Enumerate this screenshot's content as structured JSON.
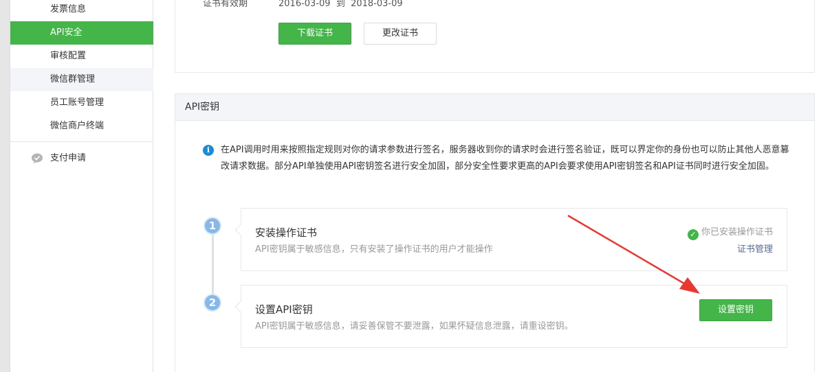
{
  "sidebar": {
    "items": [
      {
        "label": "发票信息"
      },
      {
        "label": "API安全"
      },
      {
        "label": "审核配置"
      },
      {
        "label": "微信群管理"
      },
      {
        "label": "员工账号管理"
      },
      {
        "label": "微信商户终端"
      }
    ],
    "parent_label": "支付申请"
  },
  "cert": {
    "validity_label": "证书有效期",
    "validity_value": "2016-03-09  到  2018-03-09",
    "download_label": "下载证书",
    "change_label": "更改证书"
  },
  "api_key": {
    "header": "API密钥",
    "tip": "在API调用时用来按照指定规则对你的请求参数进行签名，服务器收到你的请求时会进行签名验证，既可以界定你的身份也可以防止其他人恶意篡改请求数据。部分API单独使用API密钥签名进行安全加固，部分安全性要求更高的API会要求使用API密钥签名和API证书同时进行安全加固。",
    "steps": [
      {
        "number": "1",
        "title": "安装操作证书",
        "desc": "API密钥属于敏感信息，只有安装了操作证书的用户才能操作",
        "status": "你已安装操作证书",
        "link": "证书管理"
      },
      {
        "number": "2",
        "title": "设置API密钥",
        "desc": "API密钥属于敏感信息，请妥善保管不要泄露，如果怀疑信息泄露，请重设密钥。",
        "button": "设置密钥"
      }
    ]
  },
  "colors": {
    "accent": "#44b549",
    "link": "#576b95",
    "step_badge": "#87b8ea",
    "annotation_arrow": "#e8382f"
  },
  "icons": {
    "info": "info-icon",
    "check": "check-circle-icon",
    "pay": "wechat-pay-icon"
  }
}
